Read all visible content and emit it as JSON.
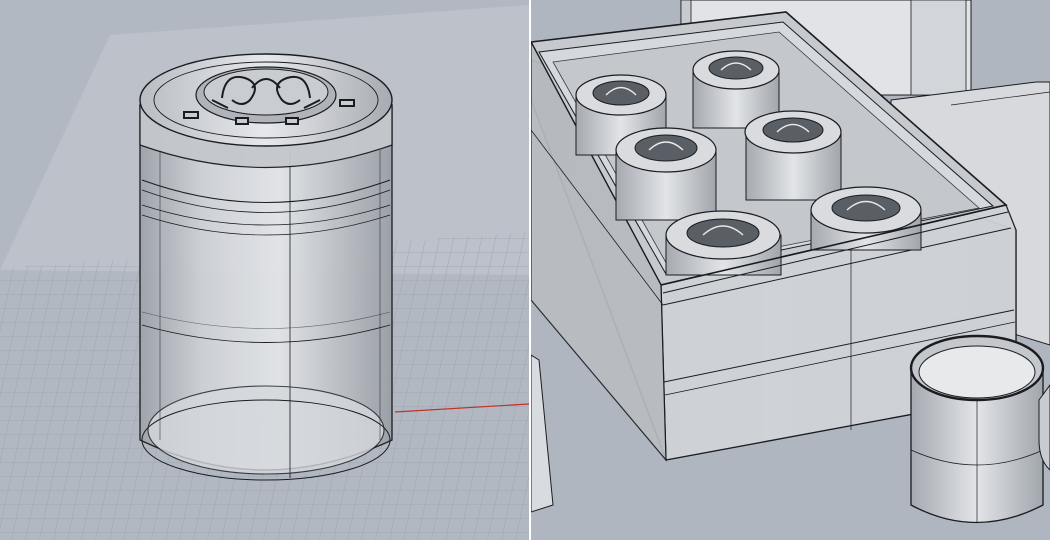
{
  "viewports": [
    {
      "id": "left",
      "label": "",
      "display_mode": "shaded-with-edges",
      "background": "#b2b8c2",
      "object": "single-canister"
    },
    {
      "id": "right",
      "label": "",
      "display_mode": "shaded-with-edges",
      "background": "#b0b6c0",
      "object": "tin-box-with-six-canisters"
    }
  ],
  "colors": {
    "grid": "#9aa1ac",
    "grid_major": "#8b929d",
    "x_axis": "#c0302a",
    "edge": "#1a1c20",
    "surface": "#d8dade",
    "surface_dark": "#a9adb3"
  }
}
